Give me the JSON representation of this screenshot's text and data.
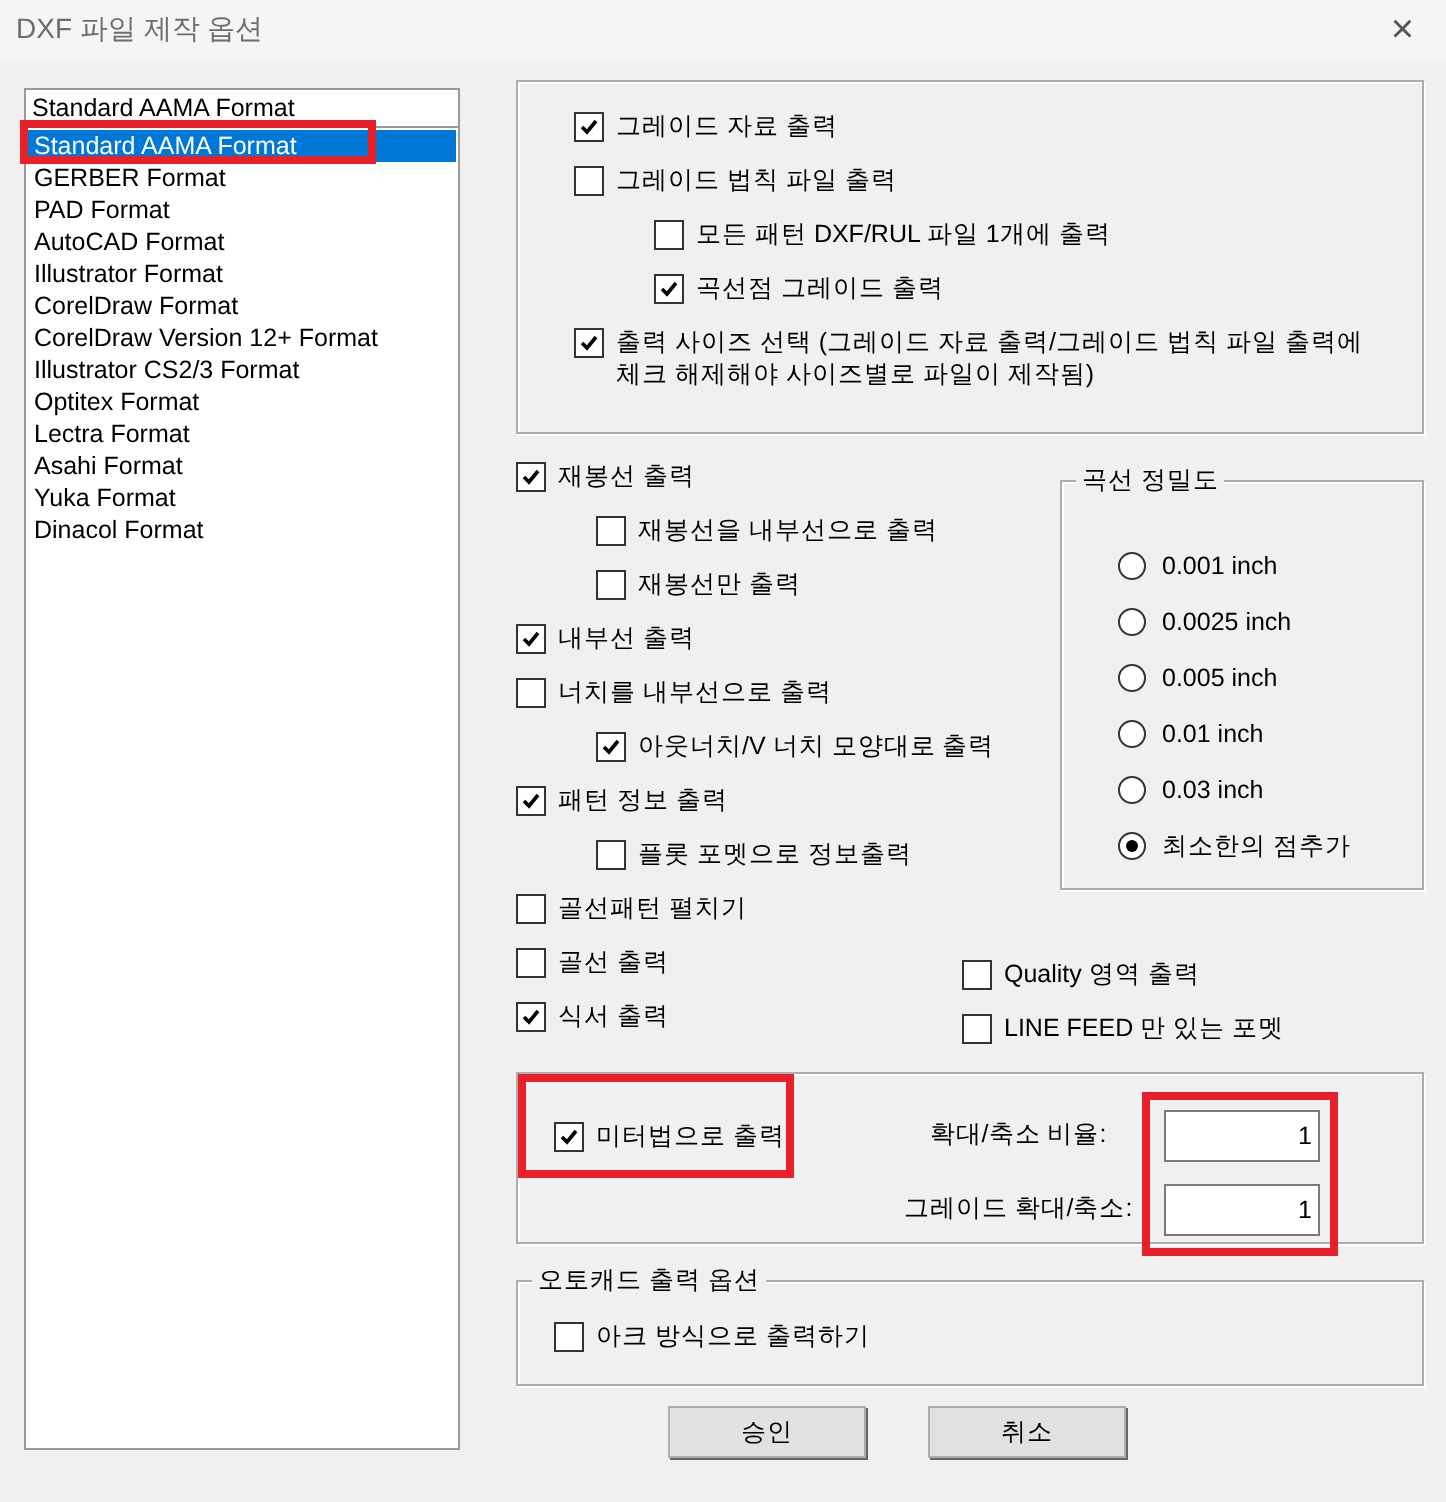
{
  "window": {
    "title": "DXF 파일 제작 옵션",
    "close": "×"
  },
  "format_combo": {
    "value": "Standard AAMA Format"
  },
  "format_list": {
    "items": [
      {
        "label": "Standard AAMA Format",
        "selected": true,
        "highlighted": true
      },
      {
        "label": "GERBER Format",
        "selected": false,
        "highlighted": false
      },
      {
        "label": "PAD Format",
        "selected": false,
        "highlighted": false
      },
      {
        "label": "AutoCAD Format",
        "selected": false,
        "highlighted": false
      },
      {
        "label": "Illustrator Format",
        "selected": false,
        "highlighted": false
      },
      {
        "label": "CorelDraw Format",
        "selected": false,
        "highlighted": false
      },
      {
        "label": "CorelDraw Version 12+ Format",
        "selected": false,
        "highlighted": false
      },
      {
        "label": "Illustrator CS2/3 Format",
        "selected": false,
        "highlighted": false
      },
      {
        "label": "Optitex Format",
        "selected": false,
        "highlighted": false
      },
      {
        "label": "Lectra Format",
        "selected": false,
        "highlighted": false
      },
      {
        "label": "Asahi Format",
        "selected": false,
        "highlighted": false
      },
      {
        "label": "Yuka Format",
        "selected": false,
        "highlighted": false
      },
      {
        "label": "Dinacol Format",
        "selected": false,
        "highlighted": false
      }
    ]
  },
  "grade_options": [
    {
      "label": "그레이드 자료 출력",
      "checked": true
    },
    {
      "label": "그레이드 법칙 파일 출력",
      "checked": false,
      "children": [
        {
          "label": "모든 패턴 DXF/RUL 파일 1개에 출력",
          "checked": false
        },
        {
          "label": "곡선점 그레이드 출력",
          "checked": true
        }
      ]
    },
    {
      "label": "출력 사이즈 선택 (그레이드 자료 출력/그레이드 법칙 파일 출력에 체크 해제해야 사이즈별로 파일이 제작됨)",
      "checked": true
    }
  ],
  "output_options": [
    {
      "label": "재봉선 출력",
      "checked": true,
      "children": [
        {
          "label": "재봉선을 내부선으로 출력",
          "checked": false
        },
        {
          "label": "재봉선만 출력",
          "checked": false
        }
      ]
    },
    {
      "label": "내부선 출력",
      "checked": true
    },
    {
      "label": "너치를 내부선으로 출력",
      "checked": false,
      "children": [
        {
          "label": "아웃너치/V 너치 모양대로 출력",
          "checked": true
        }
      ]
    },
    {
      "label": "패턴 정보 출력",
      "checked": true,
      "children": [
        {
          "label": "플롯 포멧으로 정보출력",
          "checked": false
        }
      ]
    },
    {
      "label": "골선패턴 펼치기",
      "checked": false
    },
    {
      "label": "골선 출력",
      "checked": false
    },
    {
      "label": "식서 출력",
      "checked": true
    }
  ],
  "curve_precision": {
    "title": "곡선 정밀도",
    "options": [
      {
        "label": "0.001 inch",
        "selected": false
      },
      {
        "label": "0.0025 inch",
        "selected": false
      },
      {
        "label": "0.005 inch",
        "selected": false
      },
      {
        "label": "0.01 inch",
        "selected": false
      },
      {
        "label": "0.03 inch",
        "selected": false
      },
      {
        "label": "최소한의 점추가",
        "selected": true
      }
    ]
  },
  "extra_options": [
    {
      "label": "Quality 영역 출력",
      "checked": false
    },
    {
      "label": "LINE FEED 만 있는 포멧",
      "checked": false
    }
  ],
  "scale": {
    "metric": {
      "label": "미터법으로 출력",
      "checked": true,
      "highlighted": true
    },
    "fields_highlighted": true,
    "fields": [
      {
        "label": "확대/축소 비율:",
        "value": "1"
      },
      {
        "label": "그레이드 확대/축소:",
        "value": "1"
      }
    ]
  },
  "autocad": {
    "title": "오토캐드 출력 옵션",
    "options": [
      {
        "label": "아크 방식으로 출력하기",
        "checked": false
      }
    ]
  },
  "buttons": [
    "승인",
    "취소"
  ]
}
